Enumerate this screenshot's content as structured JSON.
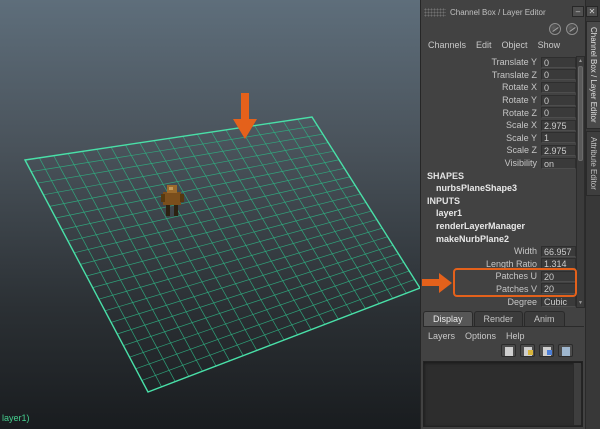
{
  "window": {
    "title": "Channel Box / Layer Editor",
    "icons": {
      "minimize": "–",
      "close": "✕"
    }
  },
  "viewport": {
    "camera_label": "layer1)",
    "grid": {
      "patches_u": 20,
      "patches_v": 20
    },
    "colors": {
      "grid_line": "#2fae81",
      "grid_border": "#49e0a8",
      "annotation_orange": "#e4611b"
    }
  },
  "channel_box": {
    "menus": [
      "Channels",
      "Edit",
      "Object",
      "Show"
    ],
    "rows": [
      {
        "type": "attr",
        "label": "Translate Y",
        "value": "0"
      },
      {
        "type": "attr",
        "label": "Translate Z",
        "value": "0"
      },
      {
        "type": "attr",
        "label": "Rotate X",
        "value": "0"
      },
      {
        "type": "attr",
        "label": "Rotate Y",
        "value": "0"
      },
      {
        "type": "attr",
        "label": "Rotate Z",
        "value": "0"
      },
      {
        "type": "attr",
        "label": "Scale X",
        "value": "2.975"
      },
      {
        "type": "attr",
        "label": "Scale Y",
        "value": "1"
      },
      {
        "type": "attr",
        "label": "Scale Z",
        "value": "2.975"
      },
      {
        "type": "attr",
        "label": "Visibility",
        "value": "on"
      },
      {
        "type": "section",
        "label": "SHAPES"
      },
      {
        "type": "node",
        "label": "nurbsPlaneShape3"
      },
      {
        "type": "section",
        "label": "INPUTS"
      },
      {
        "type": "node",
        "label": "layer1"
      },
      {
        "type": "node",
        "label": "renderLayerManager"
      },
      {
        "type": "node",
        "label": "makeNurbPlane2"
      },
      {
        "type": "attr",
        "label": "Width",
        "value": "66.957"
      },
      {
        "type": "attr",
        "label": "Length Ratio",
        "value": "1.314"
      },
      {
        "type": "attr",
        "label": "Patches U",
        "value": "20",
        "highlight": true
      },
      {
        "type": "attr",
        "label": "Patches V",
        "value": "20",
        "highlight": true
      },
      {
        "type": "attr",
        "label": "Degree",
        "value": "Cubic"
      }
    ]
  },
  "layer_editor": {
    "tabs": [
      "Display",
      "Render",
      "Anim"
    ],
    "active_tab": "Display",
    "menus": [
      "Layers",
      "Options",
      "Help"
    ],
    "icon_names": [
      "create-empty-layer-icon",
      "create-layer-from-selected-icon",
      "create-render-layer-icon",
      "layer-options-icon"
    ]
  },
  "side_tabs": [
    {
      "label": "Channel Box / Layer Editor",
      "active": true
    },
    {
      "label": "Attribute Editor",
      "active": false
    }
  ]
}
